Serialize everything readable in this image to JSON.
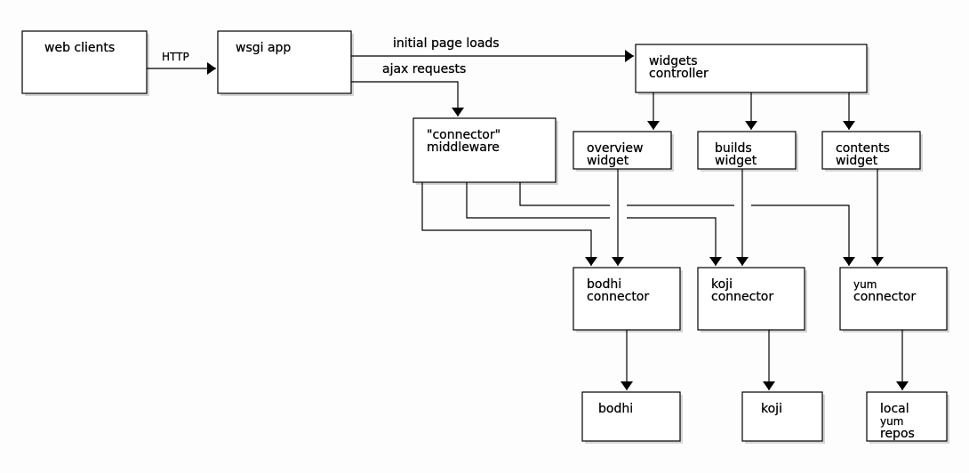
{
  "nodes": {
    "web_clients": [
      "web clients"
    ],
    "wsgi_app": [
      "wsgi app"
    ],
    "widgets_controller": [
      "widgets",
      "controller"
    ],
    "connector_middleware": [
      "\"connector\"",
      "middleware"
    ],
    "overview_widget": [
      "overview",
      "widget"
    ],
    "builds_widget": [
      "builds",
      "widget"
    ],
    "contents_widget": [
      "contents",
      "widget"
    ],
    "bodhi_connector": [
      "bodhi",
      "connector"
    ],
    "koji_connector": [
      "koji",
      "connector"
    ],
    "yum_connector": [
      "yum",
      "connector"
    ],
    "bodhi": [
      "bodhi"
    ],
    "koji": [
      "koji"
    ],
    "local_yum_repos": [
      "local",
      "yum",
      "repos"
    ]
  },
  "edges": {
    "http": "HTTP",
    "initial_page_loads": "initial page loads",
    "ajax_requests": "ajax requests"
  }
}
